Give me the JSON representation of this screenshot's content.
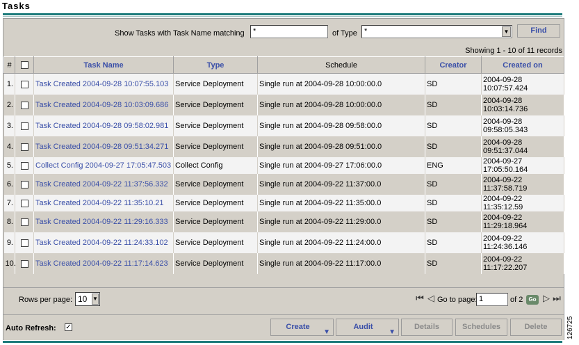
{
  "page": {
    "title": "Tasks",
    "figure_id": "126725"
  },
  "filter": {
    "name_label": "Show Tasks with Task Name matching",
    "name_value": "*",
    "type_label": "of Type",
    "type_value": "*",
    "find_label": "Find"
  },
  "summary": {
    "showing": "Showing 1 - 10 of 11 records"
  },
  "table": {
    "headers": {
      "num": "#",
      "name": "Task Name",
      "type": "Type",
      "schedule": "Schedule",
      "creator": "Creator",
      "created": "Created on"
    },
    "rows": [
      {
        "num": "1.",
        "name": "Task Created 2004-09-28 10:07:55.103",
        "type": "Service Deployment",
        "schedule": "Single run at 2004-09-28 10:00:00.0",
        "creator": "SD",
        "created_date": "2004-09-28",
        "created_time": "10:07:57.424"
      },
      {
        "num": "2.",
        "name": "Task Created 2004-09-28 10:03:09.686",
        "type": "Service Deployment",
        "schedule": "Single run at 2004-09-28 10:00:00.0",
        "creator": "SD",
        "created_date": "2004-09-28",
        "created_time": "10:03:14.736"
      },
      {
        "num": "3.",
        "name": "Task Created 2004-09-28 09:58:02.981",
        "type": "Service Deployment",
        "schedule": "Single run at 2004-09-28 09:58:00.0",
        "creator": "SD",
        "created_date": "2004-09-28",
        "created_time": "09:58:05.343"
      },
      {
        "num": "4.",
        "name": "Task Created 2004-09-28 09:51:34.271",
        "type": "Service Deployment",
        "schedule": "Single run at 2004-09-28 09:51:00.0",
        "creator": "SD",
        "created_date": "2004-09-28",
        "created_time": "09:51:37.044"
      },
      {
        "num": "5.",
        "name": "Collect Config 2004-09-27 17:05:47.503",
        "type": "Collect Config",
        "schedule": "Single run at 2004-09-27 17:06:00.0",
        "creator": "ENG",
        "created_date": "2004-09-27",
        "created_time": "17:05:50.164"
      },
      {
        "num": "6.",
        "name": "Task Created 2004-09-22 11:37:56.332",
        "type": "Service Deployment",
        "schedule": "Single run at 2004-09-22 11:37:00.0",
        "creator": "SD",
        "created_date": "2004-09-22",
        "created_time": "11:37:58.719"
      },
      {
        "num": "7.",
        "name": "Task Created 2004-09-22 11:35:10.21",
        "type": "Service Deployment",
        "schedule": "Single run at 2004-09-22 11:35:00.0",
        "creator": "SD",
        "created_date": "2004-09-22 11:35:12.59",
        "created_time": ""
      },
      {
        "num": "8.",
        "name": "Task Created 2004-09-22 11:29:16.333",
        "type": "Service Deployment",
        "schedule": "Single run at 2004-09-22 11:29:00.0",
        "creator": "SD",
        "created_date": "2004-09-22",
        "created_time": "11:29:18.964"
      },
      {
        "num": "9.",
        "name": "Task Created 2004-09-22 11:24:33.102",
        "type": "Service Deployment",
        "schedule": "Single run at 2004-09-22 11:24:00.0",
        "creator": "SD",
        "created_date": "2004-09-22",
        "created_time": "11:24:36.146"
      },
      {
        "num": "10.",
        "name": "Task Created 2004-09-22 11:17:14.623",
        "type": "Service Deployment",
        "schedule": "Single run at 2004-09-22 11:17:00.0",
        "creator": "SD",
        "created_date": "2004-09-22",
        "created_time": "11:17:22.207"
      }
    ]
  },
  "pager": {
    "rows_label": "Rows per page:",
    "rows_value": "10",
    "goto_label": "Go to page:",
    "page_value": "1",
    "of_pages": "of 2",
    "go_label": "Go"
  },
  "footer": {
    "auto_refresh_label": "Auto Refresh:",
    "buttons": {
      "create": "Create",
      "audit": "Audit",
      "details": "Details",
      "schedules": "Schedules",
      "delete": "Delete"
    }
  },
  "colors": {
    "link": "#3a4fa8",
    "accent_line": "#1d7b7b",
    "panel": "#d4d0c8"
  }
}
